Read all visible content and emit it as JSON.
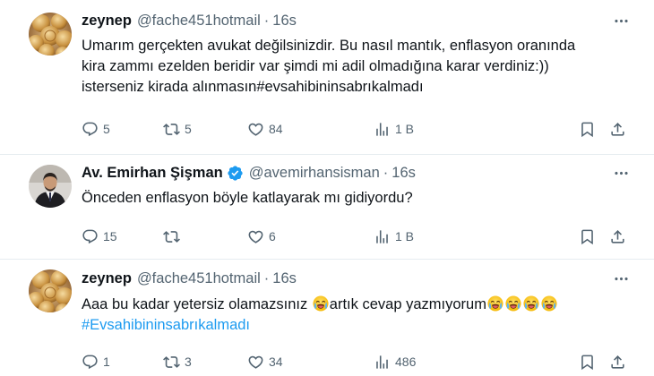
{
  "colors": {
    "text": "#0f1419",
    "secondary": "#536471",
    "link": "#1d9bf0",
    "divider": "#e6ecf0",
    "verified": "#1d9bf0"
  },
  "tweets": [
    {
      "name": "zeynep",
      "handle": "@fache451hotmail",
      "dot": "·",
      "time": "16s",
      "avatar_icon": "avatar-coins-photo",
      "lines": [
        "Umarım gerçekten avukat değilsinizdir. Bu nasıl mantık, enflasyon oranında",
        "kira zammı ezelden beridir var şimdi mi adil olmadığına karar verdiniz:))",
        "isterseniz kirada alınmasın#evsahibininsabrıkalmadı"
      ],
      "actions": {
        "reply": "5",
        "retweet": "5",
        "like": "84",
        "views": "1 B"
      }
    },
    {
      "name": "Av. Emirhan Şişman",
      "handle": "@avemirhansisman",
      "dot": "·",
      "time": "16s",
      "verified": true,
      "avatar_icon": "avatar-portrait-photo",
      "lines": [
        "Önceden enflasyon böyle katlayarak mı gidiyordu?"
      ],
      "actions": {
        "reply": "15",
        "retweet": "",
        "like": "6",
        "views": "1 B"
      }
    },
    {
      "name": "zeynep",
      "handle": "@fache451hotmail",
      "dot": "·",
      "time": "16s",
      "avatar_icon": "avatar-coins-photo",
      "line1_a": "Aaa bu kadar yetersiz olamazsınız ",
      "line1_b": "artık cevap yazmıyorum",
      "hashtag": "#Evsahibininsabrıkalmadı",
      "emoji_icon": "crying-face-emoji",
      "actions": {
        "reply": "1",
        "retweet": "3",
        "like": "34",
        "views": "486"
      }
    }
  ],
  "icons": {
    "reply": "reply-icon",
    "retweet": "retweet-icon",
    "like": "heart-icon",
    "views": "views-chart-icon",
    "bookmark": "bookmark-icon",
    "share": "share-icon",
    "more": "more-dots-icon",
    "verified": "verified-badge-icon"
  }
}
